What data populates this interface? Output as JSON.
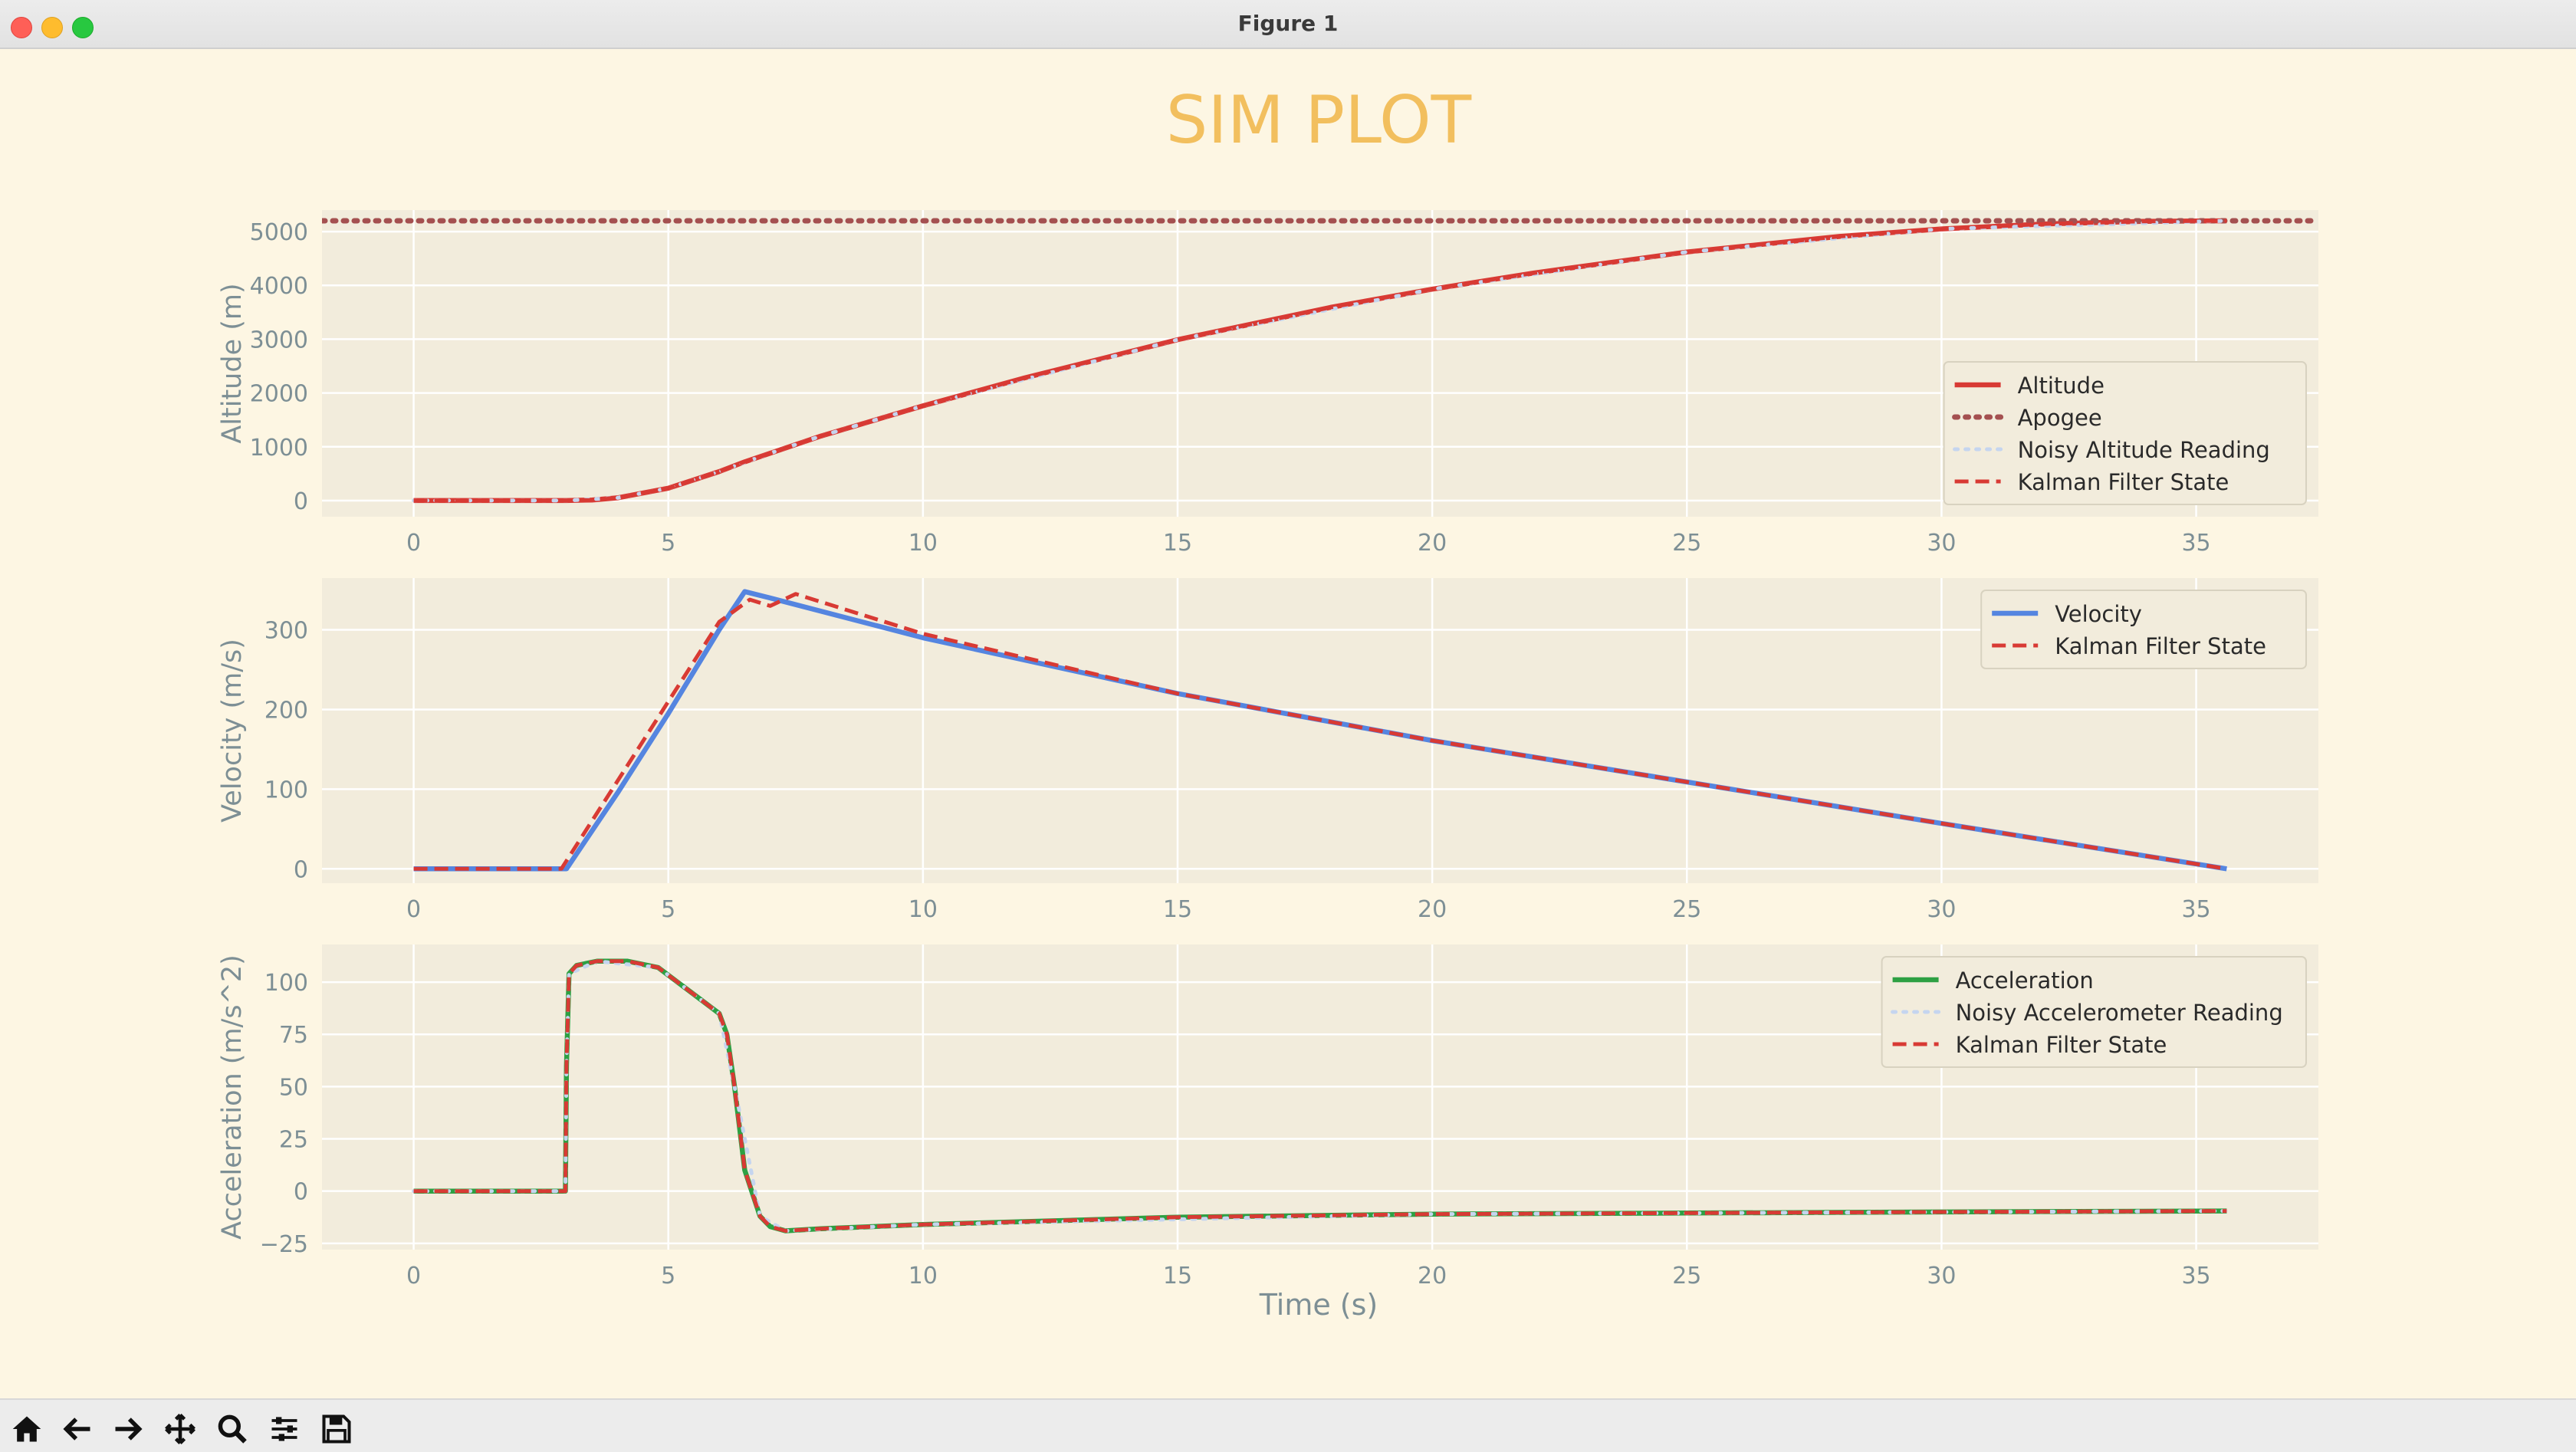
{
  "window": {
    "title": "Figure 1"
  },
  "figure": {
    "title": "SIM PLOT",
    "xlabel": "Time (s)"
  },
  "colors": {
    "background": "#fdf6e3",
    "axes_bg": "#f2ecdc",
    "grid": "#ffffff",
    "text": "#7d8f95",
    "title": "#f2bf5e",
    "altitude": "#d83a34",
    "apogee": "#a45050",
    "kalman": "#d83a34",
    "noisy": "#c5d5ef",
    "velocity": "#5585e0",
    "acceleration": "#2ea043"
  },
  "toolbar": [
    {
      "name": "home-button",
      "icon": "home-icon"
    },
    {
      "name": "back-button",
      "icon": "arrow-left-icon"
    },
    {
      "name": "forward-button",
      "icon": "arrow-right-icon"
    },
    {
      "name": "pan-button",
      "icon": "move-icon"
    },
    {
      "name": "zoom-button",
      "icon": "magnifier-icon"
    },
    {
      "name": "configure-subplots-button",
      "icon": "sliders-icon"
    },
    {
      "name": "save-button",
      "icon": "floppy-icon"
    }
  ],
  "chart_data": [
    {
      "type": "line",
      "ylabel": "Altitude (m)",
      "xlim": [
        -1.8,
        37.4
      ],
      "ylim": [
        -300,
        5400
      ],
      "xticks": [
        0,
        5,
        10,
        15,
        20,
        25,
        30,
        35
      ],
      "yticks": [
        0,
        1000,
        2000,
        3000,
        4000,
        5000
      ],
      "legend_position": "lower-right",
      "legend": [
        "Altitude",
        "Apogee",
        "Noisy Altitude Reading",
        "Kalman Filter State"
      ],
      "series": [
        {
          "name": "Altitude",
          "style": "solid",
          "x": [
            0,
            3,
            3.5,
            4,
            5,
            6,
            6.5,
            7,
            8,
            10,
            12,
            15,
            18,
            20,
            22,
            25,
            28,
            30,
            32,
            34,
            35.6
          ],
          "y": [
            0,
            0,
            10,
            50,
            230,
            540,
            720,
            880,
            1200,
            1760,
            2280,
            2990,
            3590,
            3930,
            4230,
            4620,
            4910,
            5050,
            5140,
            5190,
            5200
          ]
        },
        {
          "name": "Apogee",
          "style": "dotted",
          "x": [
            -1.8,
            37.4
          ],
          "y": [
            5200,
            5200
          ]
        },
        {
          "name": "Noisy Altitude Reading",
          "style": "dotted",
          "x": [
            0,
            3,
            4,
            5,
            6,
            7,
            8,
            10,
            15,
            20,
            25,
            30,
            35.6
          ],
          "y": [
            0,
            0,
            50,
            230,
            540,
            880,
            1200,
            1760,
            2990,
            3930,
            4620,
            5050,
            5200
          ]
        },
        {
          "name": "Kalman Filter State",
          "style": "dashed",
          "x": [
            0,
            3,
            3.5,
            4,
            5,
            6,
            6.5,
            7,
            8,
            10,
            12,
            15,
            18,
            20,
            22,
            25,
            28,
            30,
            32,
            34,
            35.6
          ],
          "y": [
            0,
            0,
            10,
            50,
            230,
            540,
            720,
            880,
            1200,
            1760,
            2280,
            2990,
            3590,
            3930,
            4230,
            4620,
            4910,
            5050,
            5140,
            5190,
            5200
          ]
        }
      ]
    },
    {
      "type": "line",
      "ylabel": "Velocity (m/s)",
      "xlim": [
        -1.8,
        37.4
      ],
      "ylim": [
        -18,
        365
      ],
      "xticks": [
        0,
        5,
        10,
        15,
        20,
        25,
        30,
        35
      ],
      "yticks": [
        0,
        100,
        200,
        300
      ],
      "legend_position": "top-right",
      "legend": [
        "Velocity",
        "Kalman Filter State"
      ],
      "series": [
        {
          "name": "Velocity",
          "style": "solid",
          "x": [
            0,
            3,
            4,
            5,
            6,
            6.5,
            7,
            10,
            15,
            20,
            25,
            30,
            35.6
          ],
          "y": [
            0,
            0,
            95,
            195,
            300,
            348,
            340,
            290,
            220,
            161,
            109,
            57,
            0
          ]
        },
        {
          "name": "Kalman Filter State",
          "style": "dashed",
          "x": [
            0,
            2.9,
            3.3,
            4,
            5,
            6,
            6.6,
            7,
            7.5,
            10,
            15,
            20,
            25,
            30,
            35.6
          ],
          "y": [
            0,
            0,
            40,
            110,
            210,
            310,
            338,
            330,
            345,
            295,
            220,
            161,
            109,
            57,
            0
          ]
        }
      ]
    },
    {
      "type": "line",
      "ylabel": "Acceleration (m/s^2)",
      "xlim": [
        -1.8,
        37.4
      ],
      "ylim": [
        -28,
        118
      ],
      "xticks": [
        0,
        5,
        10,
        15,
        20,
        25,
        30,
        35
      ],
      "yticks": [
        -25,
        0,
        25,
        50,
        75,
        100
      ],
      "legend_position": "top-right",
      "legend": [
        "Acceleration",
        "Noisy Accelerometer Reading",
        "Kalman Filter State"
      ],
      "series": [
        {
          "name": "Acceleration",
          "style": "solid",
          "x": [
            0,
            2.98,
            3.0,
            3.05,
            3.2,
            3.6,
            4.2,
            4.8,
            5.4,
            6.0,
            6.15,
            6.3,
            6.5,
            6.8,
            7.0,
            7.3,
            8,
            10,
            15,
            20,
            25,
            30,
            35.6
          ],
          "y": [
            0,
            0,
            60,
            104,
            108,
            110,
            110,
            107,
            96,
            85,
            75,
            50,
            10,
            -12,
            -17,
            -19,
            -18,
            -16,
            -12.5,
            -11,
            -10.5,
            -10,
            -9.5
          ]
        },
        {
          "name": "Noisy Accelerometer Reading",
          "style": "dotted",
          "x": [
            0,
            2.98,
            3.0,
            3.05,
            3.6,
            4.8,
            6.0,
            6.3,
            6.8,
            7.3,
            10,
            20,
            35.6
          ],
          "y": [
            0,
            0,
            60,
            104,
            110,
            107,
            85,
            50,
            -12,
            -19,
            -16,
            -11,
            -9.5
          ]
        },
        {
          "name": "Kalman Filter State",
          "style": "dashed",
          "x": [
            0,
            2.98,
            3.0,
            3.05,
            3.2,
            3.6,
            4.2,
            4.8,
            5.4,
            6.0,
            6.15,
            6.3,
            6.5,
            6.8,
            7.0,
            7.3,
            8,
            10,
            15,
            20,
            25,
            30,
            35.6
          ],
          "y": [
            0,
            0,
            60,
            104,
            108,
            110,
            110,
            107,
            96,
            85,
            75,
            50,
            10,
            -12,
            -17,
            -19,
            -18,
            -16,
            -12.5,
            -11,
            -10.5,
            -10,
            -9.5
          ]
        }
      ]
    }
  ]
}
